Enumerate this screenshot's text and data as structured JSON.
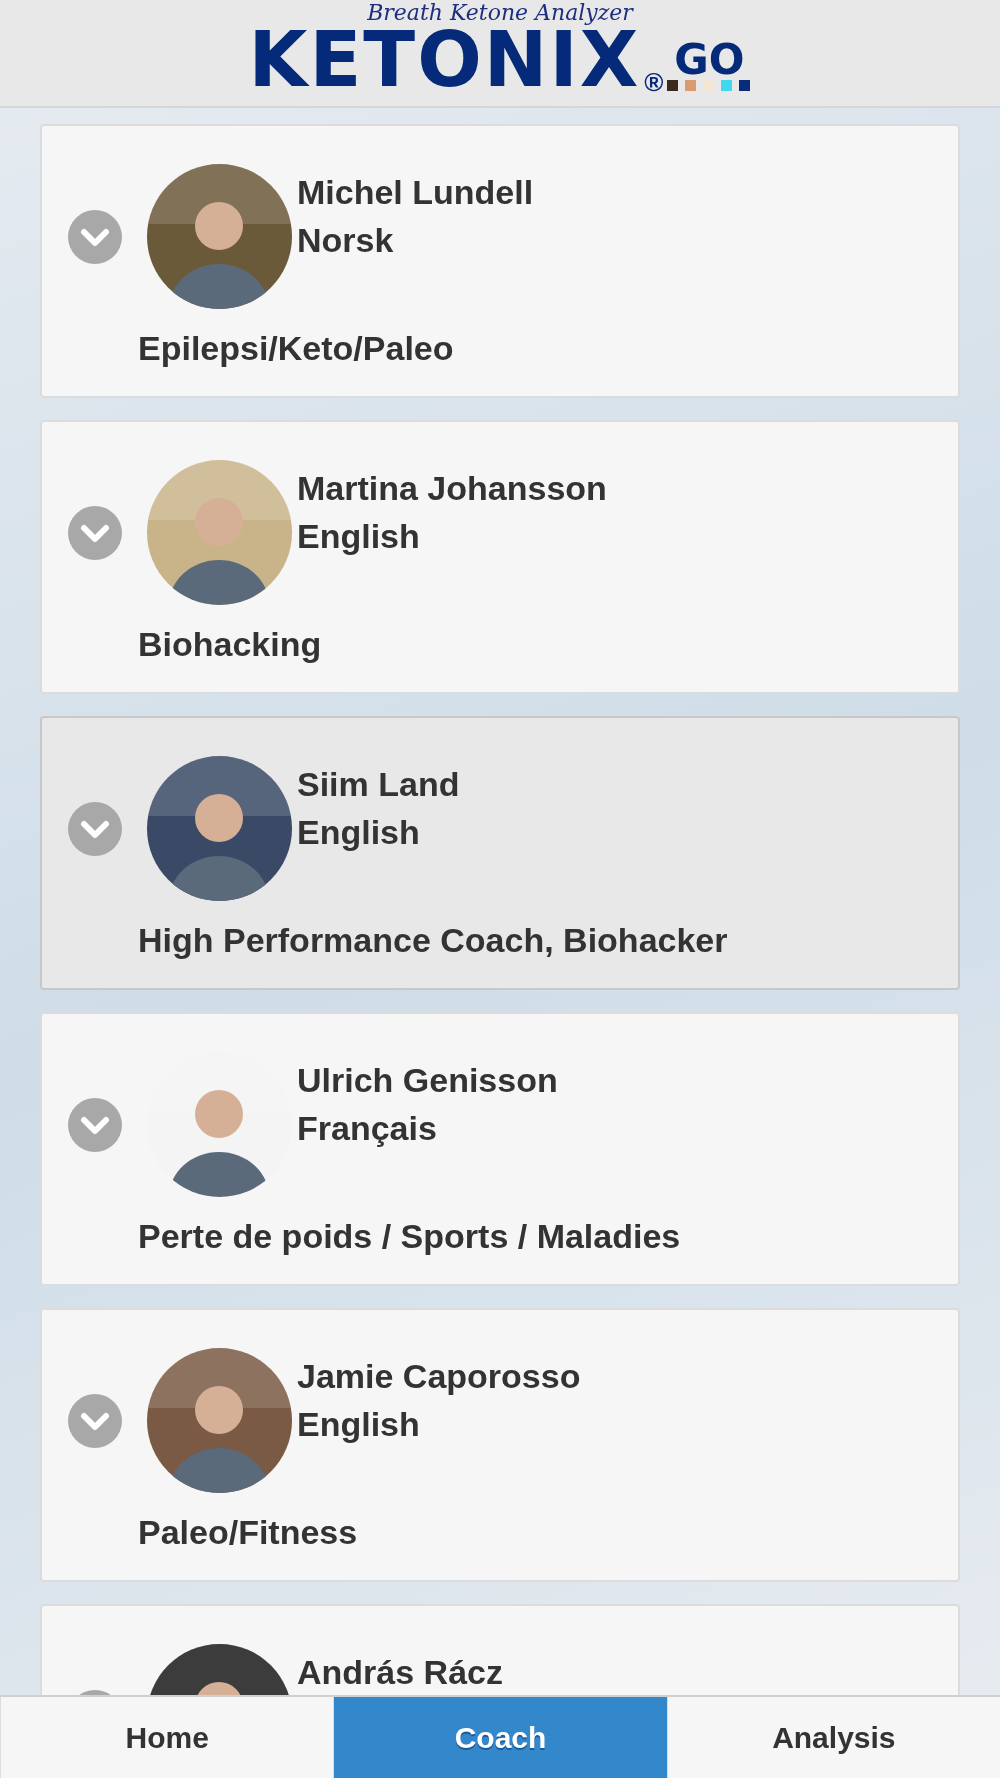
{
  "header": {
    "tagline": "Breath Ketone Analyzer",
    "brand": "KETONIX",
    "registered": "®",
    "suffix": "GO"
  },
  "coaches": [
    {
      "name": "Michel Lundell",
      "language": "Norsk",
      "specialty": "Epilepsi/Keto/Paleo",
      "selected": false
    },
    {
      "name": "Martina Johansson",
      "language": "English",
      "specialty": "Biohacking",
      "selected": false
    },
    {
      "name": "Siim Land",
      "language": "English",
      "specialty": "High Performance Coach, Biohacker",
      "selected": true
    },
    {
      "name": "Ulrich Genisson",
      "language": "Français",
      "specialty": "Perte de poids / Sports / Maladies",
      "selected": false
    },
    {
      "name": "Jamie Caporosso",
      "language": "English",
      "specialty": "Paleo/Fitness",
      "selected": false
    },
    {
      "name": "András Rácz",
      "selected": false
    }
  ],
  "tabs": [
    {
      "label": "Home",
      "selected": false
    },
    {
      "label": "Coach",
      "selected": true
    },
    {
      "label": "Analysis",
      "selected": false
    }
  ]
}
